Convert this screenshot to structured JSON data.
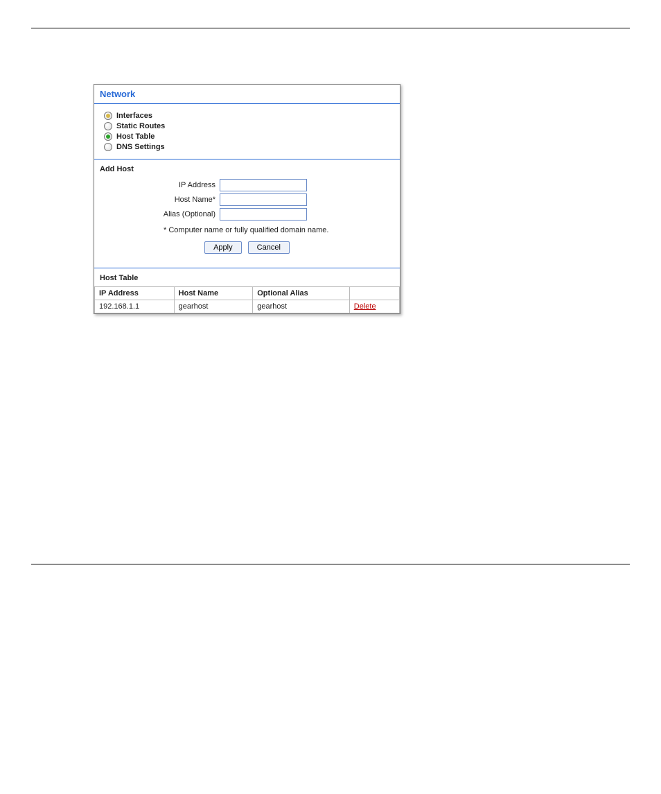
{
  "panel_title": "Network",
  "radios": [
    {
      "label": "Interfaces",
      "state": "yellow"
    },
    {
      "label": "Static Routes",
      "state": "off"
    },
    {
      "label": "Host Table",
      "state": "green"
    },
    {
      "label": "DNS Settings",
      "state": "off"
    }
  ],
  "add_host": {
    "title": "Add Host",
    "ip_label": "IP Address",
    "hostname_label": "Host Name*",
    "alias_label": "Alias (Optional)",
    "note": "* Computer name or fully qualified domain name.",
    "apply": "Apply",
    "cancel": "Cancel"
  },
  "host_table": {
    "title": "Host Table",
    "headers": {
      "ip": "IP Address",
      "host": "Host Name",
      "alias": "Optional Alias",
      "action": ""
    },
    "rows": [
      {
        "ip": "192.168.1.1",
        "host": "gearhost",
        "alias": "gearhost",
        "action": "Delete"
      }
    ]
  }
}
